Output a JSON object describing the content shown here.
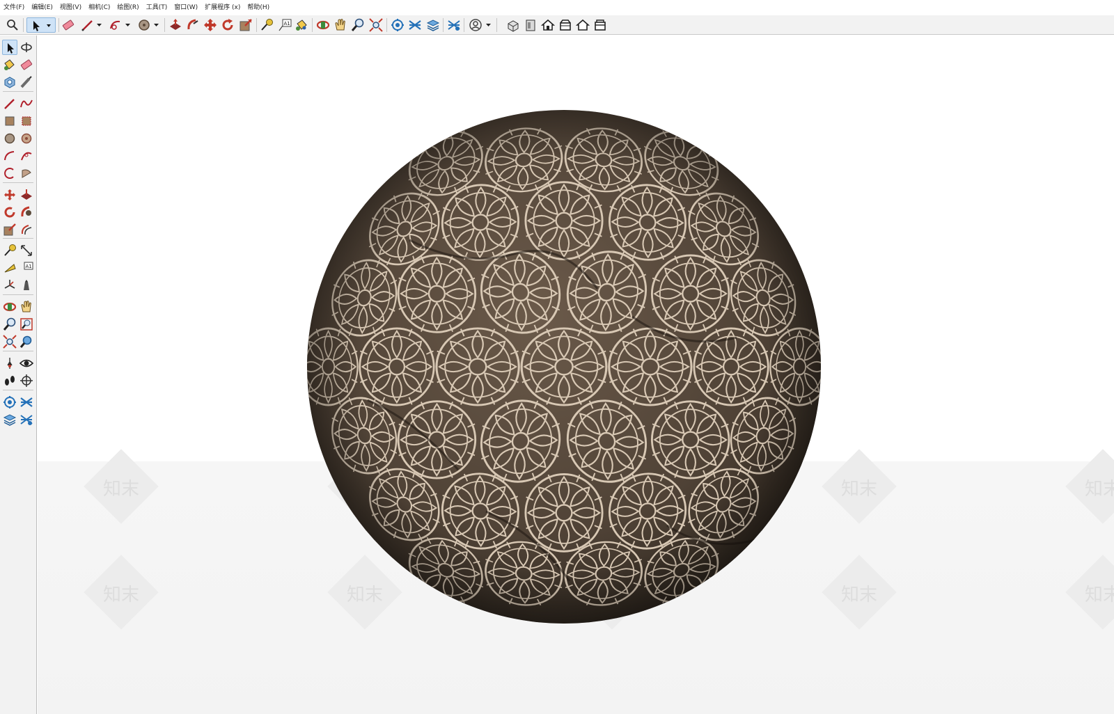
{
  "menubar": {
    "items": [
      "文件(F)",
      "编辑(E)",
      "视图(V)",
      "相机(C)",
      "绘图(R)",
      "工具(T)",
      "窗口(W)",
      "扩展程序 (x)",
      "帮助(H)"
    ]
  },
  "toolbar": {
    "icons": [
      "search-icon",
      "select-arrow-icon",
      "eraser-icon",
      "line-pencil-icon",
      "arc-icon",
      "circle-icon",
      "push-pull-icon",
      "follow-me-icon",
      "move-icon",
      "rotate-icon",
      "scale-icon",
      "tape-measure-icon",
      "text-icon",
      "paint-bucket-icon",
      "orbit-icon",
      "pan-icon",
      "zoom-icon",
      "zoom-extents-icon",
      "warehouse-icon",
      "extension-icon",
      "layers-icon",
      "styles-icon",
      "account-icon",
      "iso-view-icon",
      "front-view-icon",
      "top-view-icon",
      "left-view-icon",
      "right-view-icon",
      "back-view-icon"
    ]
  },
  "lefttoolbar": {
    "icons": [
      "select-icon",
      "orbit-small-icon",
      "paint-icon",
      "eraser-icon",
      "component-icon",
      "pencil-icon",
      "line-icon",
      "freehand-icon",
      "rectangle-icon",
      "rotated-rectangle-icon",
      "circle-icon",
      "polygon-icon",
      "arc-icon",
      "two-point-arc-icon",
      "three-point-arc-icon",
      "pie-icon",
      "move-icon",
      "push-pull-icon",
      "rotate-icon",
      "follow-me-icon",
      "scale-icon",
      "offset-icon",
      "tape-measure-icon",
      "dimension-icon",
      "protractor-icon",
      "text-icon",
      "axes-icon",
      "3d-text-icon",
      "orbit-icon",
      "pan-icon",
      "zoom-icon",
      "zoom-window-icon",
      "zoom-extents-icon",
      "previous-view-icon",
      "position-camera-icon",
      "look-around-icon",
      "walk-icon",
      "section-plane-icon",
      "warehouse-icon",
      "extension-warehouse-icon",
      "layer-icon",
      "styles-icon"
    ]
  },
  "viewport": {
    "watermark": "知末",
    "object": "sphere-with-mandala-texture"
  },
  "colors": {
    "accent": "#2b6cb0",
    "sphere_dark": "#4b3f34",
    "sphere_light": "#d8c8b4",
    "icon_red": "#c0392b"
  }
}
